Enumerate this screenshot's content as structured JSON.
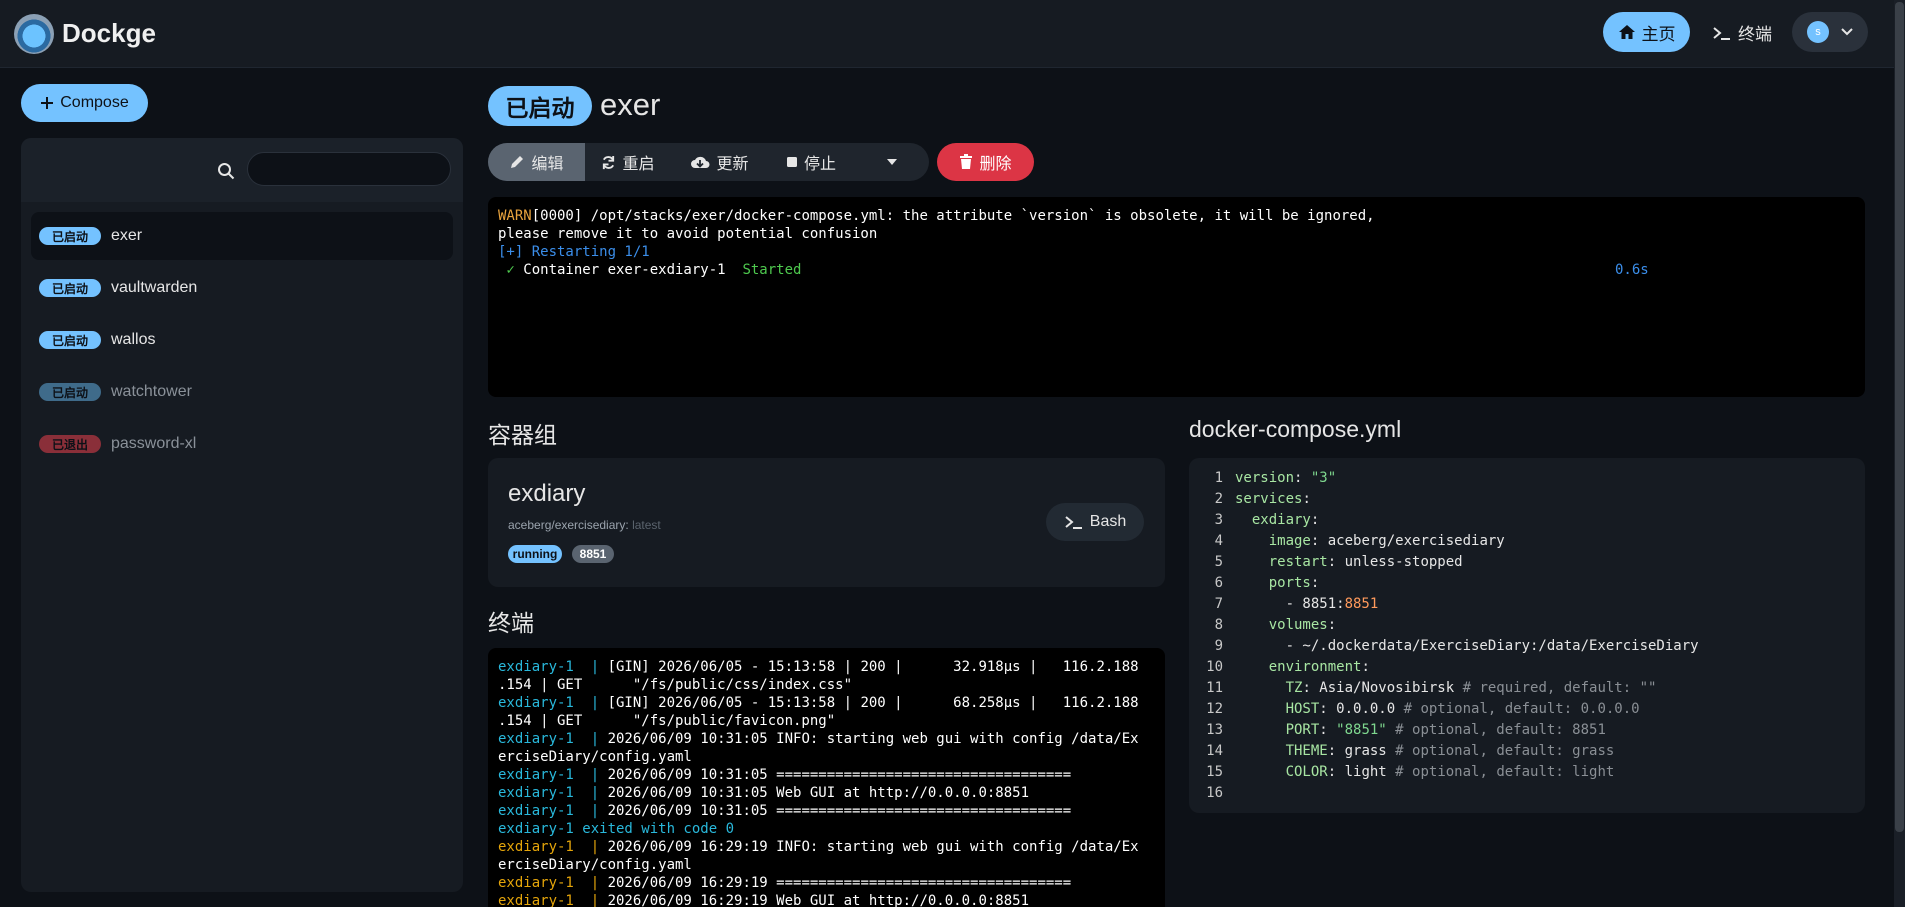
{
  "header": {
    "brand": "Dockge",
    "home_label": "主页",
    "terminal_label": "终端",
    "avatar_initial": "s"
  },
  "sidebar": {
    "compose_label": "Compose",
    "search_placeholder": "",
    "stacks": [
      {
        "status": "已启动",
        "name": "exer",
        "active": true,
        "badge_color": "#74c2ff",
        "name_color": "#e6e6e6"
      },
      {
        "status": "已启动",
        "name": "vaultwarden",
        "active": false,
        "badge_color": "#74c2ff",
        "name_color": "#e6e6e6"
      },
      {
        "status": "已启动",
        "name": "wallos",
        "active": false,
        "badge_color": "#74c2ff",
        "name_color": "#e6e6e6"
      },
      {
        "status": "已启动",
        "name": "watchtower",
        "active": false,
        "badge_color": "#3f6b8a",
        "name_color": "#8a9199"
      },
      {
        "status": "已退出",
        "name": "password-xl",
        "active": false,
        "badge_color": "#8a2f39",
        "name_color": "#8a9199"
      }
    ]
  },
  "main": {
    "status": "已启动",
    "title": "exer",
    "actions": {
      "edit": "编辑",
      "restart": "重启",
      "update": "更新",
      "stop": "停止",
      "delete": "删除"
    },
    "console": {
      "warn_prefix": "WARN",
      "warn_text": "[0000] /opt/stacks/exer/docker-compose.yml: the attribute `version` is obsolete, it will be ignored,",
      "warn_text2": "please remove it to avoid potential confusion",
      "restarting": "[+] Restarting 1/1",
      "check": " ✓",
      "container_line": " Container exer-exdiary-1  ",
      "started": "Started",
      "time": "0.6s"
    },
    "containers_title": "容器组",
    "container": {
      "name": "exdiary",
      "image": "aceberg/exercisediary:",
      "tag": "latest",
      "state": "running",
      "port": "8851",
      "bash_label": "Bash"
    },
    "terminal_title": "终端",
    "terminal_lines": [
      {
        "prefix": "exdiary-1  | ",
        "color": "cyan",
        "text": "[GIN] 2026/06/05 - 15:13:58 | 200 |      32.918µs |   116.2.188"
      },
      {
        "prefix": "",
        "color": "cyan",
        "text": ".154 | GET      \"/fs/public/css/index.css\""
      },
      {
        "prefix": "exdiary-1  | ",
        "color": "cyan",
        "text": "[GIN] 2026/06/05 - 15:13:58 | 200 |      68.258µs |   116.2.188"
      },
      {
        "prefix": "",
        "color": "cyan",
        "text": ".154 | GET      \"/fs/public/favicon.png\""
      },
      {
        "prefix": "exdiary-1  | ",
        "color": "cyan",
        "text": "2026/06/09 10:31:05 INFO: starting web gui with config /data/Ex"
      },
      {
        "prefix": "",
        "color": "cyan",
        "text": "erciseDiary/config.yaml"
      },
      {
        "prefix": "exdiary-1  | ",
        "color": "cyan",
        "text": "2026/06/09 10:31:05 ==================================="
      },
      {
        "prefix": "exdiary-1  | ",
        "color": "cyan",
        "text": "2026/06/09 10:31:05 Web GUI at http://0.0.0.0:8851"
      },
      {
        "prefix": "exdiary-1  | ",
        "color": "cyan",
        "text": "2026/06/09 10:31:05 ==================================="
      },
      {
        "prefix": "exdiary-1 exited with code 0",
        "color": "cyan",
        "text": ""
      },
      {
        "prefix": "exdiary-1  | ",
        "color": "orange",
        "text": "2026/06/09 16:29:19 INFO: starting web gui with config /data/Ex"
      },
      {
        "prefix": "",
        "color": "orange",
        "text": "erciseDiary/config.yaml"
      },
      {
        "prefix": "exdiary-1  | ",
        "color": "orange",
        "text": "2026/06/09 16:29:19 ==================================="
      },
      {
        "prefix": "exdiary-1  | ",
        "color": "orange",
        "text": "2026/06/09 16:29:19 Web GUI at http://0.0.0.0:8851"
      }
    ],
    "yaml_title": "docker-compose.yml",
    "yaml_lines": [
      "version: \"3\"",
      "services:",
      "  exdiary:",
      "    image: aceberg/exercisediary",
      "    restart: unless-stopped",
      "    ports:",
      "      - 8851:8851",
      "    volumes:",
      "      - ~/.dockerdata/ExerciseDiary:/data/ExerciseDiary",
      "    environment:",
      "      TZ: Asia/Novosibirsk # required, default: \"\"",
      "      HOST: 0.0.0.0 # optional, default: 0.0.0.0",
      "      PORT: \"8851\" # optional, default: 8851",
      "      THEME: grass # optional, default: grass",
      "      COLOR: light # optional, default: light",
      ""
    ]
  }
}
